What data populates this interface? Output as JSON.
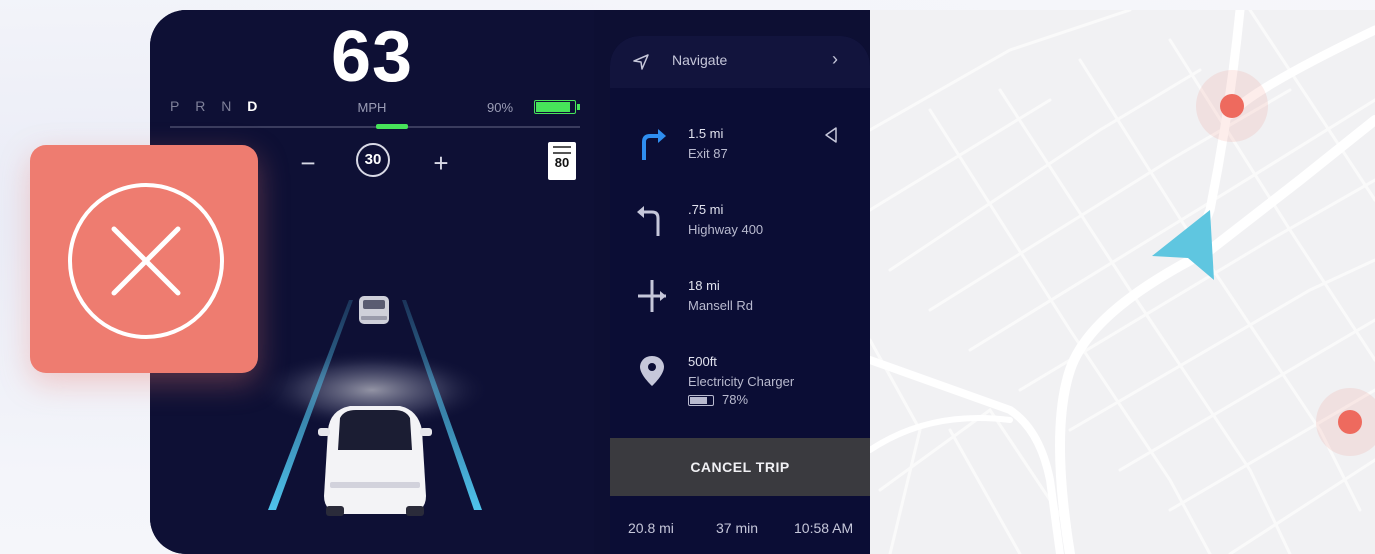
{
  "drive_panel": {
    "speed": "63",
    "gears": [
      "P",
      "R",
      "N",
      "D"
    ],
    "active_gear": "D",
    "speed_unit": "MPH",
    "battery_percent_label": "90%",
    "battery_level": 0.9,
    "cruise_decrease": "−",
    "cruise_limit": "30",
    "cruise_increase": "+",
    "speed_limit_sign": "80"
  },
  "navigation": {
    "header_label": "Navigate",
    "header_chevron": "›",
    "steps": [
      {
        "distance": "1.5 mi",
        "place": "Exit 87",
        "icon": "turn-right-arrow-icon"
      },
      {
        "distance": ".75 mi",
        "place": "Highway 400",
        "icon": "turn-left-arrow-icon"
      },
      {
        "distance": "18 mi",
        "place": "Mansell Rd",
        "icon": "intersection-icon"
      },
      {
        "distance": "500ft",
        "place": "Electricity Charger",
        "icon": "location-pin-icon",
        "charge_label": "78%",
        "charge_level": 0.78
      }
    ],
    "cancel_label": "CANCEL TRIP",
    "summary": {
      "distance": "20.8 mi",
      "duration": "37 min",
      "arrival": "10:58 AM"
    }
  },
  "map": {
    "road_color": "#ffffff",
    "background_color": "#f1f1f3",
    "marker_color": "#ee6a5e",
    "vehicle_color": "#5fc6e0"
  },
  "error_badge": {
    "icon": "close-circle-icon",
    "color": "#ee7c70"
  }
}
